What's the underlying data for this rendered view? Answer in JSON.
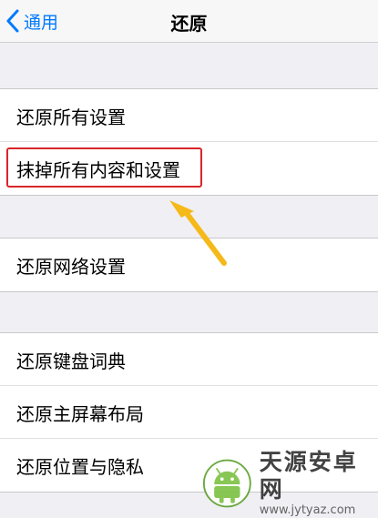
{
  "navbar": {
    "back_label": "通用",
    "title": "还原"
  },
  "sections": [
    {
      "items": [
        {
          "label": "还原所有设置"
        },
        {
          "label": "抹掉所有内容和设置"
        }
      ]
    },
    {
      "items": [
        {
          "label": "还原网络设置"
        }
      ]
    },
    {
      "items": [
        {
          "label": "还原键盘词典"
        },
        {
          "label": "还原主屏幕布局"
        },
        {
          "label": "还原位置与隐私"
        }
      ]
    }
  ],
  "annotation": {
    "highlight_color": "#d8262a",
    "arrow_color": "#f5b919"
  },
  "watermark": {
    "title": "天源安卓网",
    "url": "www.jytyaz.com",
    "icon": "android-robot-icon"
  },
  "colors": {
    "accent": "#007aff",
    "background": "#efeff4"
  }
}
